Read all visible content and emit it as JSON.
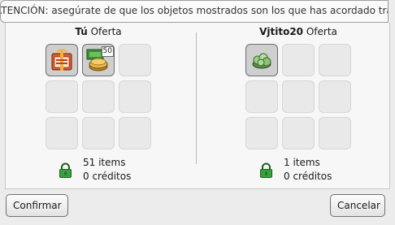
{
  "notice": {
    "text": "ATENCIÓN: asegúrate de que los objetos mostrados son los que has acordado tradear"
  },
  "left_offer": {
    "owner": "Tú",
    "label": "Oferta",
    "slots": [
      {
        "icon": "calendar-gift-icon",
        "count": ""
      },
      {
        "icon": "credit-coins-icon",
        "count": "50"
      },
      null,
      null,
      null,
      null,
      null,
      null,
      null
    ],
    "items_text": "51 items",
    "credits_text": "0 créditos",
    "lock_color": "#37a23c"
  },
  "right_offer": {
    "owner": "Vjtito20",
    "label": "Oferta",
    "slots": [
      {
        "icon": "plant-bundle-icon",
        "count": ""
      },
      null,
      null,
      null,
      null,
      null,
      null,
      null,
      null
    ],
    "items_text": "1 items",
    "credits_text": "0 créditos",
    "lock_color": "#37a23c"
  },
  "buttons": {
    "confirm": "Confirmar",
    "cancel": "Cancelar"
  }
}
